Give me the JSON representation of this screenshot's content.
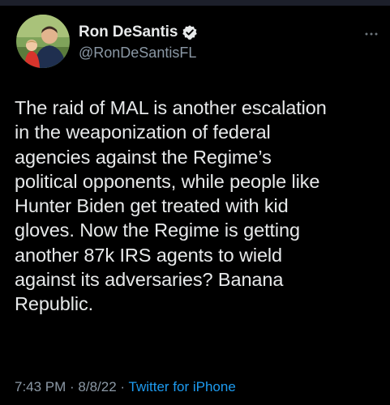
{
  "author": {
    "display_name": "Ron DeSantis",
    "handle": "@RonDeSantisFL",
    "verified": true
  },
  "tweet": {
    "lines": [
      "The raid of MAL is another escalation",
      "in the weaponization of federal",
      "agencies against the Regime’s",
      "political opponents, while people like",
      "Hunter Biden get treated with kid",
      "gloves. Now the Regime is getting",
      "another 87k IRS agents to wield",
      "against its adversaries? Banana",
      "Republic."
    ]
  },
  "meta": {
    "time": "7:43 PM",
    "separator_1": " · ",
    "date": "8/8/22",
    "separator_2": " · ",
    "source": "Twitter for iPhone"
  },
  "colors": {
    "background": "#000000",
    "text": "#e7e9ea",
    "secondary": "#8b98a5",
    "link": "#1d9bf0"
  },
  "icons": {
    "verified": "verified-badge-icon",
    "more": "more-options-icon"
  }
}
